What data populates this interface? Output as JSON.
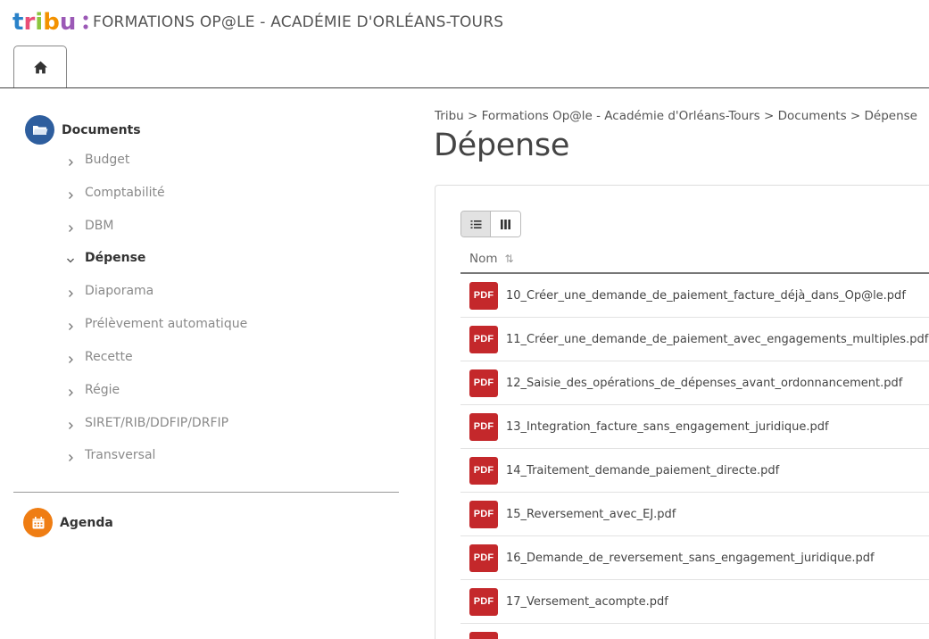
{
  "header": {
    "site_title": "FORMATIONS OP@LE - ACADÉMIE D'ORLÉANS-TOURS",
    "logo_icon": "tribu-logo"
  },
  "tabs": {
    "home_icon": "home-icon"
  },
  "sidebar": {
    "documents": {
      "label": "Documents",
      "icon": "folder-icon",
      "color": "#2e5e9e"
    },
    "items": [
      {
        "label": "Budget",
        "expanded": false
      },
      {
        "label": "Comptabilité",
        "expanded": false
      },
      {
        "label": "DBM",
        "expanded": false
      },
      {
        "label": "Dépense",
        "expanded": true
      },
      {
        "label": "Diaporama",
        "expanded": false
      },
      {
        "label": "Prélèvement automatique",
        "expanded": false
      },
      {
        "label": "Recette",
        "expanded": false
      },
      {
        "label": "Régie",
        "expanded": false
      },
      {
        "label": "SIRET/RIB/DDFIP/DRFIP",
        "expanded": false
      },
      {
        "label": "Transversal",
        "expanded": false
      }
    ],
    "agenda": {
      "label": "Agenda",
      "icon": "calendar-icon",
      "color": "#ef7d13"
    }
  },
  "main": {
    "breadcrumb": [
      "Tribu",
      "Formations Op@le - Académie d'Orléans-Tours",
      "Documents",
      "Dépense"
    ],
    "breadcrumb_separator": ">",
    "title": "Dépense",
    "view_toggle": {
      "list_icon": "list-view-icon",
      "grid_icon": "column-view-icon",
      "active": "list"
    },
    "column_header": {
      "label": "Nom",
      "sort_icon": "sort-icon"
    },
    "files": [
      {
        "badge": "PDF",
        "name": "10_Créer_une_demande_de_paiement_facture_déjà_dans_Op@le.pdf"
      },
      {
        "badge": "PDF",
        "name": "11_Créer_une_demande_de_paiement_avec_engagements_multiples.pdf"
      },
      {
        "badge": "PDF",
        "name": "12_Saisie_des_opérations_de_dépenses_avant_ordonnancement.pdf"
      },
      {
        "badge": "PDF",
        "name": "13_Integration_facture_sans_engagement_juridique.pdf"
      },
      {
        "badge": "PDF",
        "name": "14_Traitement_demande_paiement_directe.pdf"
      },
      {
        "badge": "PDF",
        "name": "15_Reversement_avec_EJ.pdf"
      },
      {
        "badge": "PDF",
        "name": "16_Demande_de_reversement_sans_engagement_juridique.pdf"
      },
      {
        "badge": "PDF",
        "name": "17_Versement_acompte.pdf"
      }
    ],
    "pdf_color": "#c4282b"
  }
}
